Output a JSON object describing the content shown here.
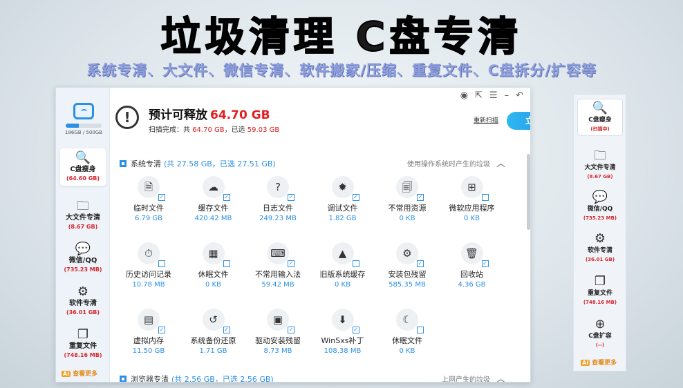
{
  "banner": {
    "title": "垃圾清理 C盘专清",
    "subtitle": "系统专清、大文件、微信专清、软件搬家/压缩、重复文件、C盘拆分/扩容等"
  },
  "colors": {
    "accent": "#2b8fe4",
    "danger": "#e02020",
    "more": "#e48a1a"
  },
  "window": {
    "disk": {
      "usage_text": "186GB / 500GB",
      "used": 186,
      "total": 500
    },
    "sidebar": [
      {
        "label": "C盘瘦身",
        "size": "(64.60 GB)",
        "icon": "disk-search-icon",
        "glyph": "🔍"
      },
      {
        "label": "大文件专清",
        "size": "(8.67 GB)",
        "icon": "folder-icon",
        "glyph": "🗀"
      },
      {
        "label": "微信/QQ",
        "size": "(735.23 MB)",
        "icon": "chat-icon",
        "glyph": "💬"
      },
      {
        "label": "软件专清",
        "size": "(36.01 GB)",
        "icon": "apps-icon",
        "glyph": "⚙"
      },
      {
        "label": "重复文件",
        "size": "(748.16 MB)",
        "icon": "duplicate-icon",
        "glyph": "❐"
      }
    ],
    "more_label": "查看更多",
    "header": {
      "estimate_label": "预计可释放",
      "estimate_value": "64.70 GB",
      "scan_prefix": "扫描完成：共",
      "scan_total": "64.70 GB",
      "scan_mid": "，已选",
      "scan_selected": "59.03 GB",
      "rescan_label": "重新扫描",
      "clean_label": "立即清理"
    },
    "section1": {
      "title": "系统专清",
      "summary": "(共 27.58 GB，已选 27.51 GB)",
      "desc": "使用操作系统时产生的垃圾"
    },
    "tiles": [
      {
        "label": "临时文件",
        "size": "6.79 GB",
        "icon": "temp-file-icon",
        "glyph": "🗎",
        "checked": true
      },
      {
        "label": "缓存文件",
        "size": "420.42 MB",
        "icon": "cloud-cache-icon",
        "glyph": "☁",
        "checked": true
      },
      {
        "label": "日志文件",
        "size": "249.23 MB",
        "icon": "log-file-icon",
        "glyph": "?",
        "checked": true
      },
      {
        "label": "调试文件",
        "size": "1.82 GB",
        "icon": "bug-icon",
        "glyph": "✹",
        "checked": true
      },
      {
        "label": "不常用资源",
        "size": "0 KB",
        "icon": "resource-icon",
        "glyph": "🗐",
        "checked": true
      },
      {
        "label": "微软应用程序",
        "size": "0 KB",
        "icon": "windows-icon",
        "glyph": "⊞",
        "checked": false
      },
      {
        "label": "历史访问记录",
        "size": "10.78 MB",
        "icon": "history-icon",
        "glyph": "⏱",
        "checked": false
      },
      {
        "label": "休眠文件",
        "size": "0 KB",
        "icon": "sleep-apps-icon",
        "glyph": "▦",
        "checked": false
      },
      {
        "label": "不常用输入法",
        "size": "59.42 MB",
        "icon": "keyboard-icon",
        "glyph": "⌨",
        "checked": true
      },
      {
        "label": "旧版系统缓存",
        "size": "0 KB",
        "icon": "old-system-icon",
        "glyph": "▲",
        "checked": false
      },
      {
        "label": "安装包残留",
        "size": "585.35 MB",
        "icon": "package-icon",
        "glyph": "⚙",
        "checked": true
      },
      {
        "label": "回收站",
        "size": "4.36 GB",
        "icon": "recycle-bin-icon",
        "glyph": "🗑",
        "checked": true
      },
      {
        "label": "虚拟内存",
        "size": "11.50 GB",
        "icon": "virtual-memory-icon",
        "glyph": "▤",
        "checked": true
      },
      {
        "label": "系统备份还原",
        "size": "1.71 GB",
        "icon": "backup-icon",
        "glyph": "↺",
        "checked": true
      },
      {
        "label": "驱动安装残留",
        "size": "8.73 MB",
        "icon": "driver-icon",
        "glyph": "▣",
        "checked": true
      },
      {
        "label": "WinSxs补丁",
        "size": "108.38 MB",
        "icon": "patch-icon",
        "glyph": "⬇",
        "checked": true
      },
      {
        "label": "休眠文件",
        "size": "0 KB",
        "icon": "moon-icon",
        "glyph": "☾",
        "checked": false
      }
    ],
    "section2": {
      "title": "浏览器专清",
      "summary": "(共 2.56 GB，已选 2.56 GB)",
      "desc": "上网产生的垃圾"
    }
  },
  "right_panel": {
    "items": [
      {
        "label": "C盘瘦身",
        "size": "(扫描中)",
        "icon": "disk-search-icon",
        "glyph": "🔍"
      },
      {
        "label": "大文件专清",
        "size": "(8.67 GB)",
        "icon": "folder-icon",
        "glyph": "🗀"
      },
      {
        "label": "微信/QQ",
        "size": "(735.23 MB)",
        "icon": "chat-icon",
        "glyph": "💬"
      },
      {
        "label": "软件专清",
        "size": "(36.01 GB)",
        "icon": "apps-icon",
        "glyph": "⚙"
      },
      {
        "label": "重复文件",
        "size": "(748.16 MB)",
        "icon": "duplicate-icon",
        "glyph": "❐"
      },
      {
        "label": "C盘扩容",
        "size": "(--)",
        "icon": "disk-expand-icon",
        "glyph": "⊕"
      }
    ],
    "more_label": "查看更多"
  }
}
